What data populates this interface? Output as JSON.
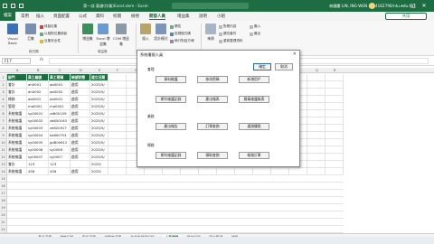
{
  "titlebar": {
    "autosave_label": "",
    "title": "第一部  基礎(作業)Excel.xlsm  -  Excel",
    "user": "林國慶 LIN, ING-WEN (H14162790/ntu.edu.tw)",
    "minimize": "–",
    "maximize": "□",
    "close": "✕"
  },
  "ribbon_tabs": [
    "檔案",
    "常用",
    "插入",
    "頁面配置",
    "公式",
    "資料",
    "校閱",
    "檢視",
    "開發人員",
    "增益集",
    "說明",
    "小組"
  ],
  "ribbon_tabs_active_index": 8,
  "share_label": "共用",
  "ribbon": {
    "visual_basic": "Visual Basic",
    "macros": "巨集",
    "record_macro": "錄製巨集",
    "relative_ref": "以相對位置錄製",
    "macro_security": "巨集安全性",
    "group_code": "程式碼",
    "addins": "增益集",
    "excel_addins": "Excel 增益集",
    "com_addins": "COM 增益集",
    "group_addins": "增益集",
    "insert": "插入",
    "design_mode": "設計模式",
    "properties": "屬性",
    "view_code": "檢視程式碼",
    "run_dialog": "執行對話方塊",
    "group_controls": "控制項",
    "source": "來源",
    "map_properties": "對應內容",
    "expansion_packs": "擴充套件",
    "refresh_data": "重新整理資料",
    "import": "匯入",
    "export": "匯出",
    "group_xml": "XML"
  },
  "formula_bar": {
    "name_box": "F17",
    "fx": "fx",
    "value": ""
  },
  "columns": [
    "A",
    "B",
    "C",
    "D",
    "E",
    "F",
    "G",
    "H",
    "I",
    "J",
    "K",
    "L",
    "M",
    "N",
    "O",
    "P",
    "Q",
    "R"
  ],
  "table": {
    "headers": [
      "部門",
      "員工編號",
      "員工密碼",
      "帳號狀態",
      "建立日期"
    ],
    "rows": [
      [
        "會計",
        "ah0001",
        "ab0001",
        "啟用",
        "2025/5/"
      ],
      [
        "會計",
        "ah0002",
        "ab0002",
        "啟用",
        "2025/5/"
      ],
      [
        "總務",
        "aa0001",
        "aa0001",
        "啟用",
        "2025/5/"
      ],
      [
        "管理",
        "ma0001",
        "ma0001",
        "啟用",
        "2025/5/"
      ],
      [
        "系統維護",
        "sy00001",
        "zz800159",
        "啟用",
        "2025/5/"
      ],
      [
        "系統維護",
        "sy00002",
        "zb800163",
        "啟用",
        "2025/5/"
      ],
      [
        "系統維護",
        "sy00003",
        "ze820917",
        "啟用",
        "2025/5/"
      ],
      [
        "系統維護",
        "sy00004",
        "ka800701",
        "啟用",
        "2025/5/"
      ],
      [
        "系統維護",
        "sy00005",
        "gd800612",
        "啟用",
        "2025/5/"
      ],
      [
        "系統維護",
        "sy00006",
        "sy0006",
        "啟用",
        "2025/5/"
      ],
      [
        "系統維護",
        "sy00007",
        "sy0007",
        "啟用",
        "2025/5/"
      ],
      [
        "會計",
        "123",
        "123",
        "",
        "2025/"
      ],
      [
        "系統維護",
        "456",
        "456",
        "啟用",
        "2025/"
      ]
    ]
  },
  "dialog": {
    "title": "系統權限人員",
    "close": "✕",
    "sections": [
      {
        "label": "會理",
        "buttons": [
          "資料維護",
          "修改密碼",
          "新增用戶"
        ]
      },
      {
        "label": "會理",
        "buttons": [
          "期刊維護記錄",
          "產出報表",
          "廢棄維護報表"
        ]
      },
      {
        "label": "業務",
        "buttons": [
          "產出報告",
          "訂單查詢",
          "通過權限"
        ]
      },
      {
        "label": "總務",
        "buttons": [
          "期刊維護記錄",
          "領取查詢",
          "帳務訂單"
        ]
      }
    ],
    "top_buttons": [
      "確定",
      "取消"
    ]
  },
  "sheet_tabs": [
    "產品清單",
    "銷售記錄",
    "客戶清單",
    "供應商清單",
    "進貨與銷貨記錄",
    "人員權限",
    "操作記錄",
    "庫存管理",
    "部門..."
  ],
  "sheet_tabs_active_index": 5,
  "status": {
    "ready": "就緒",
    "zoom": "100%"
  }
}
